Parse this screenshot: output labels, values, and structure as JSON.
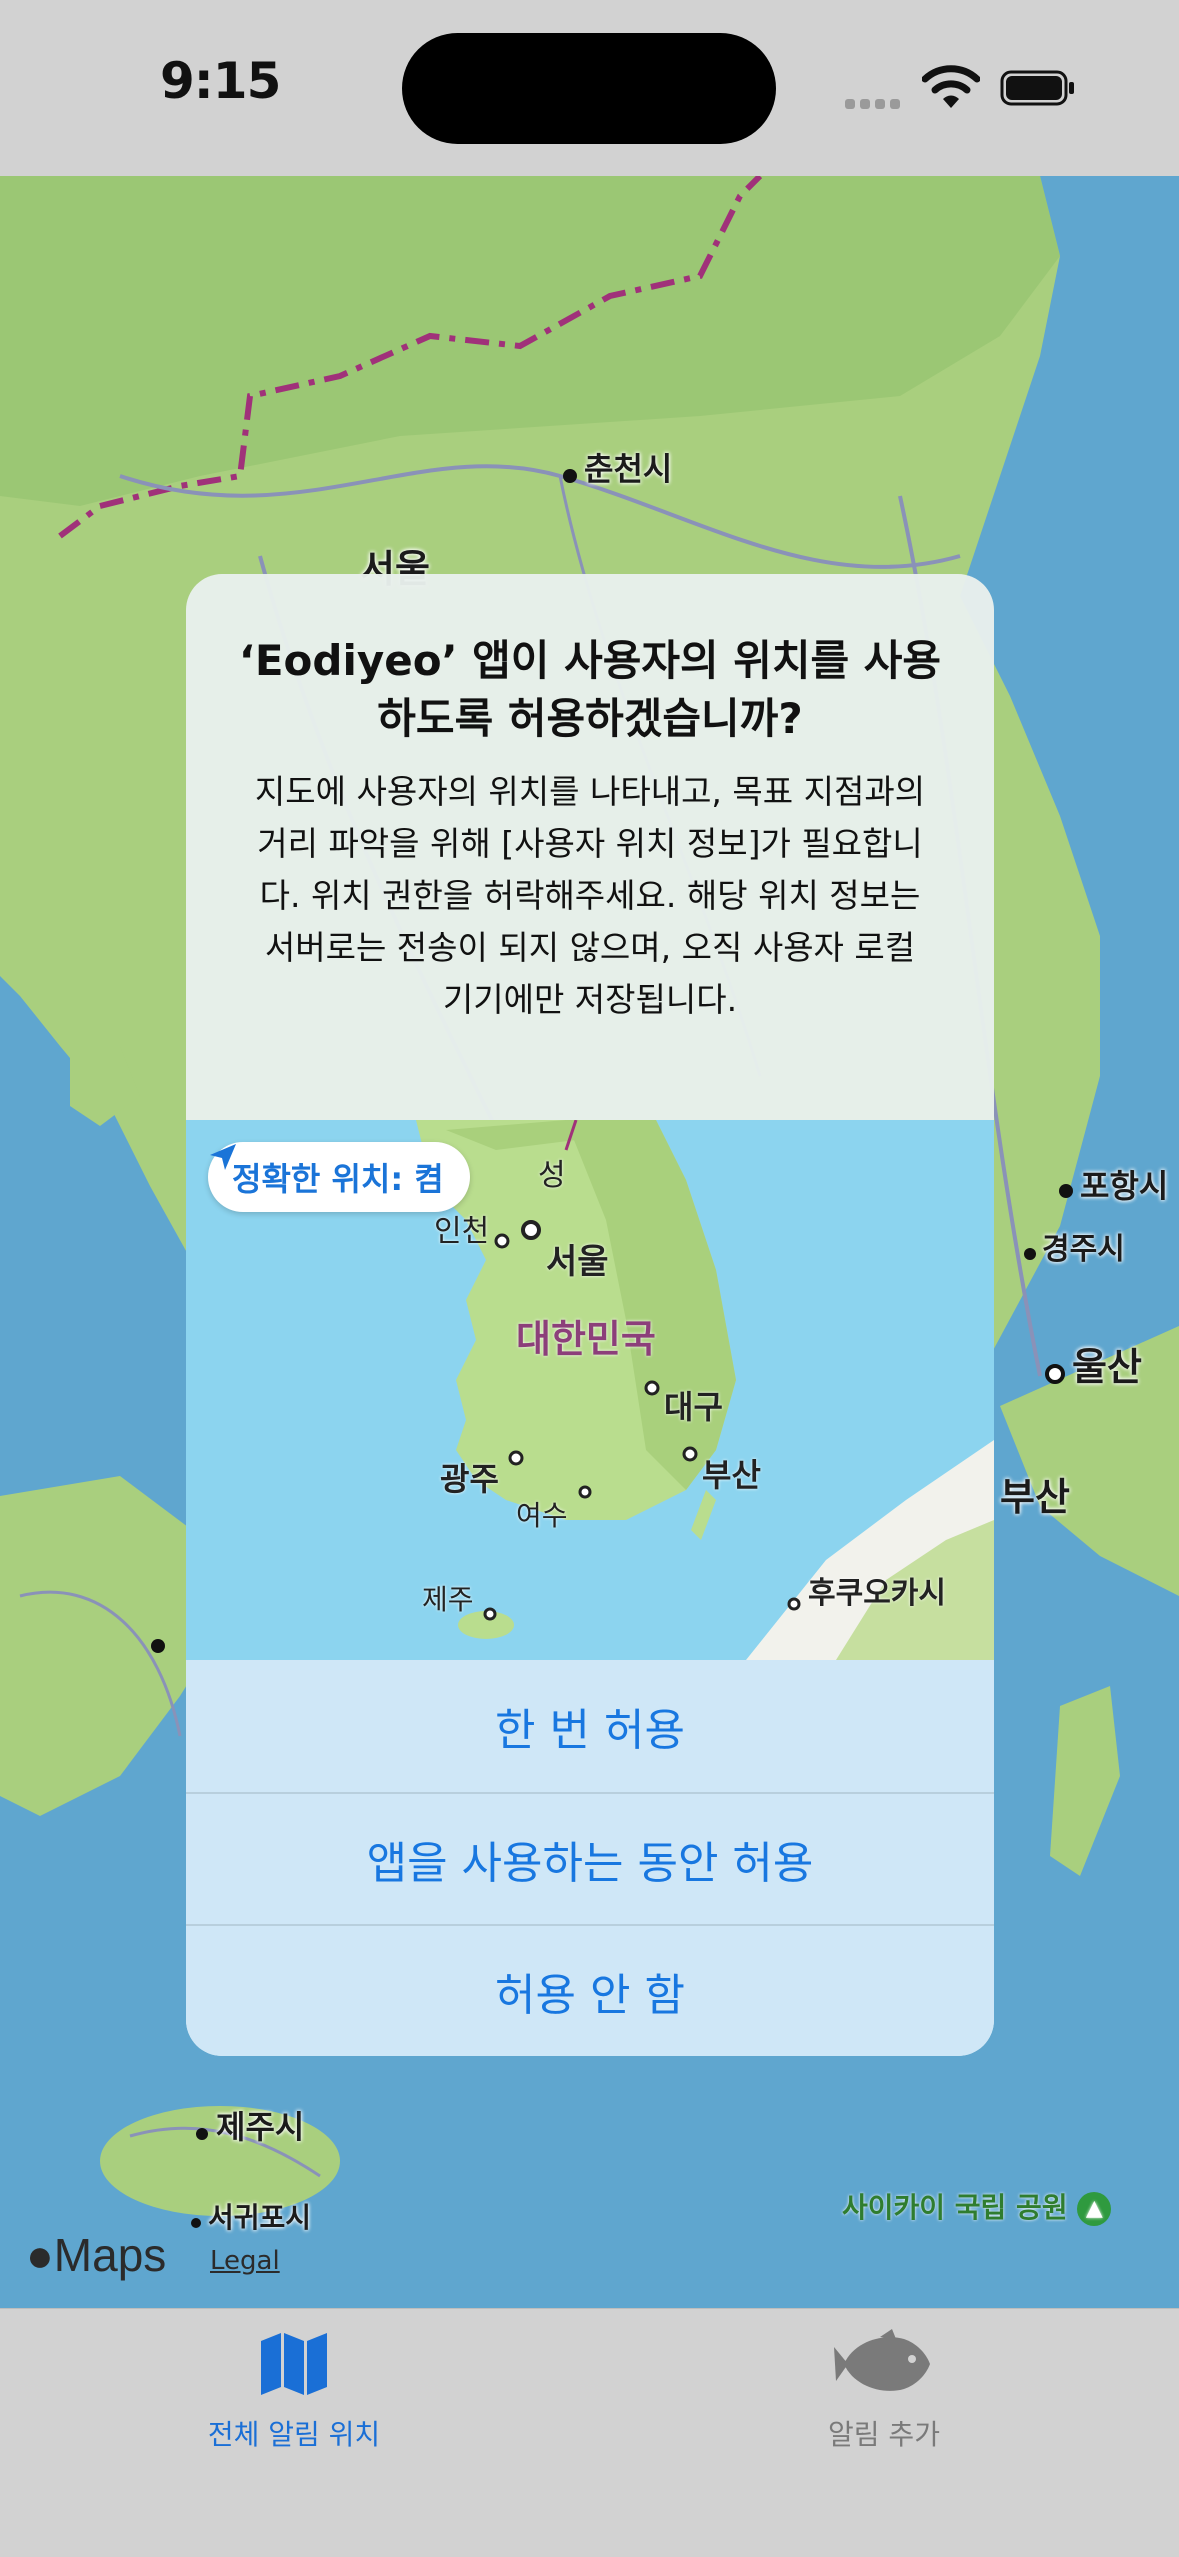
{
  "status_bar": {
    "time": "9:15"
  },
  "background_map": {
    "labels": [
      "춘천시",
      "서울",
      "포항시",
      "경주시",
      "울산",
      "부산",
      "제주시",
      "서귀포시"
    ],
    "park_label": "사이카이 국립 공원",
    "logo": "Maps",
    "legal": "Legal"
  },
  "alert": {
    "title": "‘Eodiyeo’ 앱이 사용자의 위치를 사용하도록 허용하겠습니까?",
    "message": "지도에 사용자의 위치를 나타내고, 목표 지점과의 거리 파악을 위해 [사용자 위치 정보]가 필요합니다. 위치 권한을 허락해주세요. 해당 위치 정보는 서버로는 전송이 되지 않으며, 오직 사용자 로컬 기기에만 저장됩니다.",
    "precise_location": "정확한 위치: 켬",
    "map_labels": {
      "incheon": "인천",
      "seoul": "서울",
      "country": "대한민국",
      "daegu": "대구",
      "gwangju": "광주",
      "busan": "부산",
      "yeosu": "여수",
      "jeju": "제주",
      "fukuoka": "후쿠오카시",
      "partial": "성"
    },
    "buttons": [
      "한 번 허용",
      "앱을 사용하는 동안 허용",
      "허용 안 함"
    ]
  },
  "tab_bar": {
    "tabs": [
      {
        "label": "전체 알림 위치",
        "icon": "map-icon",
        "selected": true
      },
      {
        "label": "알림 추가",
        "icon": "fish-icon",
        "selected": false
      }
    ]
  },
  "colors": {
    "accent": "#1877e0",
    "map_water": "#5fa6cf",
    "map_land": "#a9cf7e"
  }
}
